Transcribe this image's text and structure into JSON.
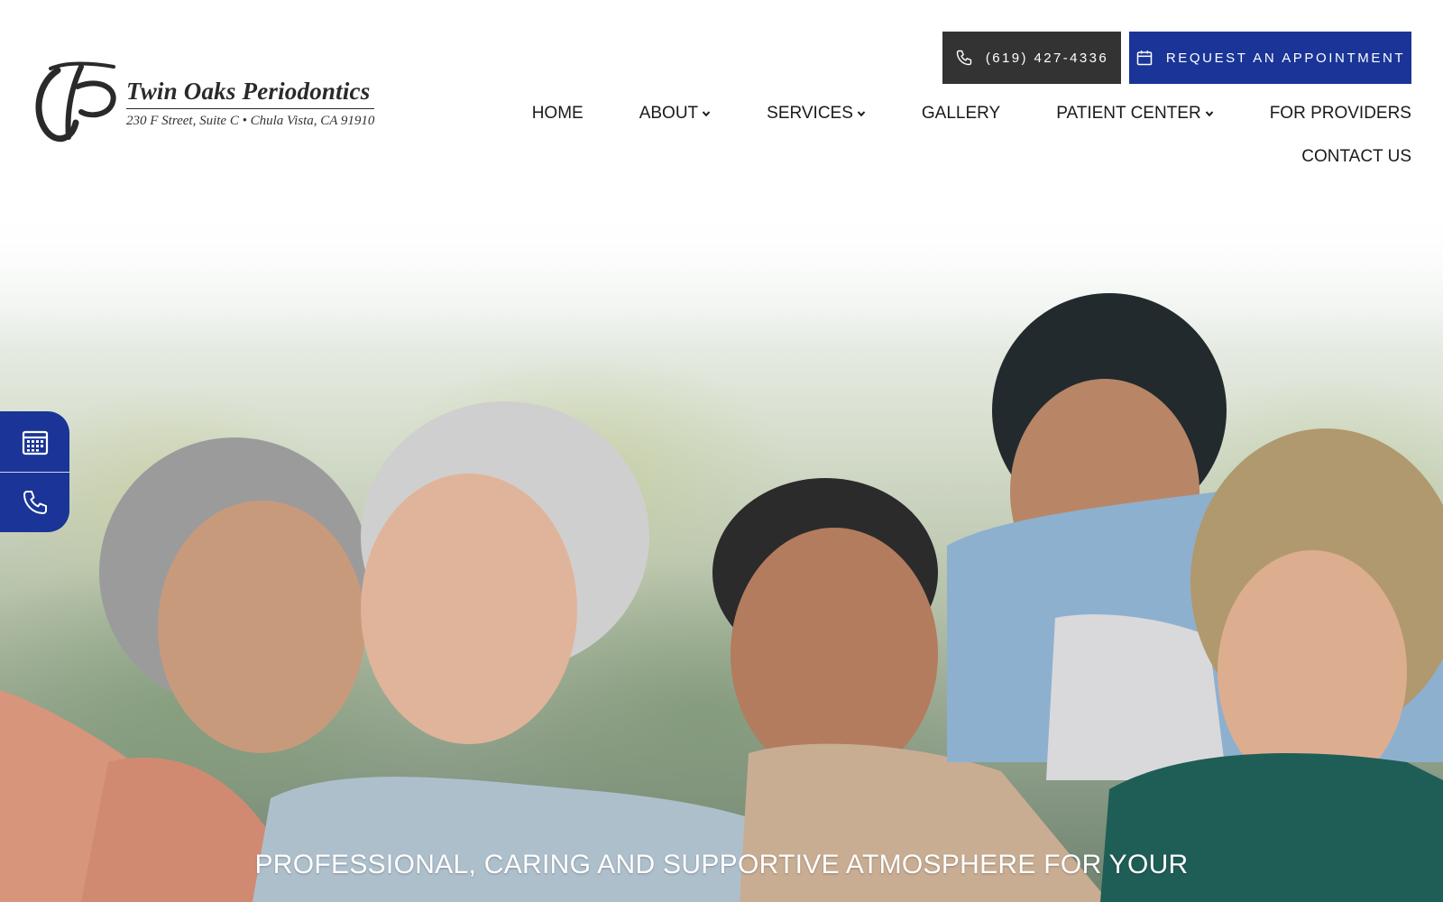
{
  "logo": {
    "name": "Twin Oaks Periodontics",
    "address": "230 F Street, Suite C • Chula Vista, CA 91910"
  },
  "header_buttons": {
    "phone": "(619) 427-4336",
    "appointment": "REQUEST AN APPOINTMENT"
  },
  "nav": {
    "row1": [
      {
        "label": "HOME",
        "dropdown": false
      },
      {
        "label": "ABOUT",
        "dropdown": true
      },
      {
        "label": "SERVICES",
        "dropdown": true
      },
      {
        "label": "GALLERY",
        "dropdown": false
      },
      {
        "label": "PATIENT CENTER",
        "dropdown": true
      },
      {
        "label": "FOR PROVIDERS",
        "dropdown": false
      }
    ],
    "row2": [
      {
        "label": "CONTACT US",
        "dropdown": false
      }
    ]
  },
  "hero": {
    "headline": "PROFESSIONAL, CARING AND SUPPORTIVE ATMOSPHERE FOR YOUR"
  },
  "side_tabs": [
    {
      "icon": "calendar-icon"
    },
    {
      "icon": "phone-icon"
    }
  ],
  "colors": {
    "brand_blue": "#1a3597",
    "dark_button": "#333333",
    "text": "#1a1a1a"
  }
}
